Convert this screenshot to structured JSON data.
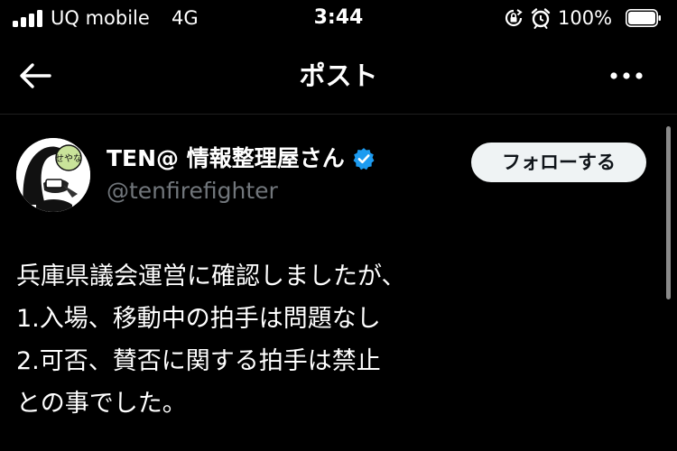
{
  "status_bar": {
    "carrier": "UQ mobile",
    "network": "4G",
    "time": "3:44",
    "battery_percent": "100%",
    "battery_level": 1.0,
    "signal_bars": 4
  },
  "nav": {
    "title": "ポスト",
    "back_icon": "arrow-left-icon",
    "more_icon": "more-horizontal-icon"
  },
  "post": {
    "author": {
      "display_name": "TEN@ 情報整理屋さん",
      "handle": "@tenfirefighter",
      "verified": true,
      "avatar_badge_text": "せやな"
    },
    "follow_label": "フォローする",
    "text_lines": [
      "兵庫県議会運営に確認しましたが、",
      "1.入場、移動中の拍手は問題なし",
      "2.可否、賛否に関する拍手は禁止",
      "との事でした。"
    ]
  },
  "colors": {
    "background": "#000000",
    "secondary_text": "#71767b",
    "verified_blue": "#1d9bf0",
    "follow_button_bg": "#eff3f4"
  }
}
